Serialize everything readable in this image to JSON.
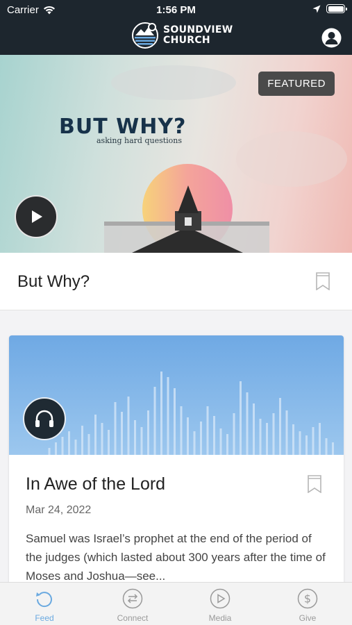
{
  "status_bar": {
    "carrier": "Carrier",
    "time": "1:56 PM"
  },
  "header": {
    "brand_line1": "SOUNDVIEW",
    "brand_line2": "CHURCH"
  },
  "hero": {
    "badge": "FEATURED",
    "title": "BUT WHY?",
    "subtitle": "asking hard questions"
  },
  "featured": {
    "title": "But Why?"
  },
  "card": {
    "title": "In Awe of the Lord",
    "date": "Mar 24, 2022",
    "excerpt": "Samuel was Israel’s prophet at the end of the period of the judges (which lasted about 300 years after the time of Moses and Joshua—see..."
  },
  "tabs": [
    {
      "label": "Feed",
      "icon": "refresh-icon",
      "active": true
    },
    {
      "label": "Connect",
      "icon": "swap-arrows-icon",
      "active": false
    },
    {
      "label": "Media",
      "icon": "play-circle-icon",
      "active": false
    },
    {
      "label": "Give",
      "icon": "dollar-icon",
      "active": false
    }
  ],
  "colors": {
    "header_bg": "#1d262e",
    "accent": "#6aa9e0",
    "badge_bg": "#4a4a4a",
    "tab_inactive": "#9a9a9a"
  }
}
